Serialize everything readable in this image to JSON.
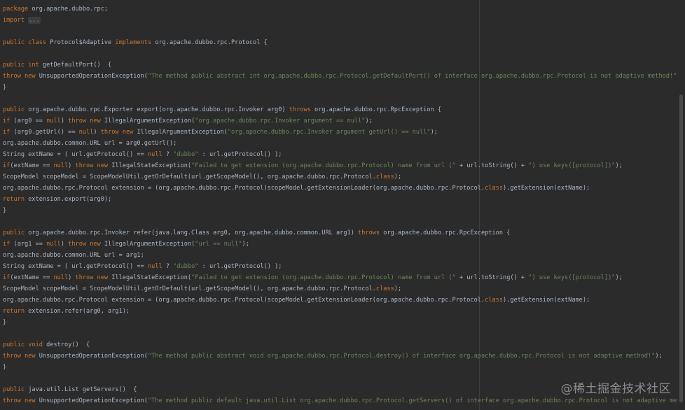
{
  "editor": {
    "lines": [
      {
        "y": 0,
        "tokens": [
          {
            "t": "package",
            "c": "kw"
          },
          {
            "t": " org.apache.dubbo.rpc;",
            "c": "plain"
          }
        ]
      },
      {
        "y": 1,
        "tokens": [
          {
            "t": "import",
            "c": "kw"
          },
          {
            "t": " ",
            "c": "plain"
          },
          {
            "t": "...",
            "c": "fold"
          }
        ]
      },
      {
        "y": 3,
        "tokens": [
          {
            "t": "public class",
            "c": "kw"
          },
          {
            "t": " Protocol$Adaptive ",
            "c": "plain"
          },
          {
            "t": "implements",
            "c": "kw"
          },
          {
            "t": " org.apache.dubbo.rpc.Protocol {",
            "c": "plain"
          }
        ]
      },
      {
        "y": 5,
        "tokens": [
          {
            "t": "public int",
            "c": "kw"
          },
          {
            "t": " getDefaultPort()  {",
            "c": "plain"
          }
        ]
      },
      {
        "y": 6,
        "tokens": [
          {
            "t": "throw new",
            "c": "kw"
          },
          {
            "t": " UnsupportedOperationException(",
            "c": "plain"
          },
          {
            "t": "\"The method public abstract int org.apache.dubbo.rpc.Protocol.getDefaultPort() of interface org.apache.dubbo.rpc.Protocol is not adaptive method!\"",
            "c": "str"
          },
          {
            "t": ");",
            "c": "plain"
          }
        ]
      },
      {
        "y": 7,
        "tokens": [
          {
            "t": "}",
            "c": "plain"
          }
        ]
      },
      {
        "y": 9,
        "tokens": [
          {
            "t": "public",
            "c": "kw"
          },
          {
            "t": " org.apache.dubbo.rpc.Exporter export(org.apache.dubbo.rpc.Invoker arg0) ",
            "c": "plain"
          },
          {
            "t": "throws",
            "c": "kw"
          },
          {
            "t": " org.apache.dubbo.rpc.RpcException {",
            "c": "plain"
          }
        ]
      },
      {
        "y": 10,
        "tokens": [
          {
            "t": "if",
            "c": "kw"
          },
          {
            "t": " (arg0 == ",
            "c": "plain"
          },
          {
            "t": "null",
            "c": "kw"
          },
          {
            "t": ") ",
            "c": "plain"
          },
          {
            "t": "throw new",
            "c": "kw"
          },
          {
            "t": " IllegalArgumentException(",
            "c": "plain"
          },
          {
            "t": "\"org.apache.dubbo.rpc.Invoker argument == null\"",
            "c": "str"
          },
          {
            "t": ");",
            "c": "plain"
          }
        ]
      },
      {
        "y": 11,
        "tokens": [
          {
            "t": "if",
            "c": "kw"
          },
          {
            "t": " (arg0.getUrl() == ",
            "c": "plain"
          },
          {
            "t": "null",
            "c": "kw"
          },
          {
            "t": ") ",
            "c": "plain"
          },
          {
            "t": "throw new",
            "c": "kw"
          },
          {
            "t": " IllegalArgumentException(",
            "c": "plain"
          },
          {
            "t": "\"org.apache.dubbo.rpc.Invoker argument getUrl() == null\"",
            "c": "str"
          },
          {
            "t": ");",
            "c": "plain"
          }
        ]
      },
      {
        "y": 12,
        "tokens": [
          {
            "t": "org.apache.dubbo.common.URL url = arg0.getUrl();",
            "c": "plain"
          }
        ]
      },
      {
        "y": 13,
        "tokens": [
          {
            "t": "String extName = ( url.getProtocol() == ",
            "c": "plain"
          },
          {
            "t": "null",
            "c": "kw"
          },
          {
            "t": " ? ",
            "c": "plain"
          },
          {
            "t": "\"dubbo\"",
            "c": "str"
          },
          {
            "t": " : url.getProtocol() );",
            "c": "plain"
          }
        ]
      },
      {
        "y": 14,
        "tokens": [
          {
            "t": "if",
            "c": "kw"
          },
          {
            "t": "(extName == ",
            "c": "plain"
          },
          {
            "t": "null",
            "c": "kw"
          },
          {
            "t": ") ",
            "c": "plain"
          },
          {
            "t": "throw new",
            "c": "kw"
          },
          {
            "t": " IllegalStateException(",
            "c": "plain"
          },
          {
            "t": "\"Failed to get extension (org.apache.dubbo.rpc.Protocol) name from url (\"",
            "c": "str"
          },
          {
            "t": " + url.toString() + ",
            "c": "plain"
          },
          {
            "t": "\") use keys([protocol])\"",
            "c": "str"
          },
          {
            "t": ");",
            "c": "plain"
          }
        ]
      },
      {
        "y": 15,
        "tokens": [
          {
            "t": "ScopeModel scopeModel = ScopeModelUtil.getOrDefault(url.getScopeModel(), org.apache.dubbo.rpc.Protocol.",
            "c": "plain"
          },
          {
            "t": "class",
            "c": "kw"
          },
          {
            "t": ");",
            "c": "plain"
          }
        ]
      },
      {
        "y": 16,
        "tokens": [
          {
            "t": "org.apache.dubbo.rpc.Protocol extension = (org.apache.dubbo.rpc.Protocol)scopeModel.getExtensionLoader(org.apache.dubbo.rpc.Protocol.",
            "c": "plain"
          },
          {
            "t": "class",
            "c": "kw"
          },
          {
            "t": ").getExtension(extName);",
            "c": "plain"
          }
        ]
      },
      {
        "y": 17,
        "tokens": [
          {
            "t": "return",
            "c": "kw"
          },
          {
            "t": " extension.export(arg0);",
            "c": "plain"
          }
        ]
      },
      {
        "y": 18,
        "tokens": [
          {
            "t": "}",
            "c": "plain"
          }
        ]
      },
      {
        "y": 20,
        "tokens": [
          {
            "t": "public",
            "c": "kw"
          },
          {
            "t": " org.apache.dubbo.rpc.Invoker refer(java.lang.Class arg0, org.apache.dubbo.common.URL arg1) ",
            "c": "plain"
          },
          {
            "t": "throws",
            "c": "kw"
          },
          {
            "t": " org.apache.dubbo.rpc.RpcException {",
            "c": "plain"
          }
        ]
      },
      {
        "y": 21,
        "tokens": [
          {
            "t": "if",
            "c": "kw"
          },
          {
            "t": " (arg1 == ",
            "c": "plain"
          },
          {
            "t": "null",
            "c": "kw"
          },
          {
            "t": ") ",
            "c": "plain"
          },
          {
            "t": "throw new",
            "c": "kw"
          },
          {
            "t": " IllegalArgumentException(",
            "c": "plain"
          },
          {
            "t": "\"url == null\"",
            "c": "str"
          },
          {
            "t": ");",
            "c": "plain"
          }
        ]
      },
      {
        "y": 22,
        "tokens": [
          {
            "t": "org.apache.dubbo.common.URL url = arg1;",
            "c": "plain"
          }
        ]
      },
      {
        "y": 23,
        "tokens": [
          {
            "t": "String extName = ( url.getProtocol() == ",
            "c": "plain"
          },
          {
            "t": "null",
            "c": "kw"
          },
          {
            "t": " ? ",
            "c": "plain"
          },
          {
            "t": "\"dubbo\"",
            "c": "str"
          },
          {
            "t": " : url.getProtocol() );",
            "c": "plain"
          }
        ]
      },
      {
        "y": 24,
        "tokens": [
          {
            "t": "if",
            "c": "kw"
          },
          {
            "t": "(extName == ",
            "c": "plain"
          },
          {
            "t": "null",
            "c": "kw"
          },
          {
            "t": ") ",
            "c": "plain"
          },
          {
            "t": "throw new",
            "c": "kw"
          },
          {
            "t": " IllegalStateException(",
            "c": "plain"
          },
          {
            "t": "\"Failed to get extension (org.apache.dubbo.rpc.Protocol) name from url (\"",
            "c": "str"
          },
          {
            "t": " + url.toString() + ",
            "c": "plain"
          },
          {
            "t": "\") use keys([protocol])\"",
            "c": "str"
          },
          {
            "t": ");",
            "c": "plain"
          }
        ]
      },
      {
        "y": 25,
        "tokens": [
          {
            "t": "ScopeModel scopeModel = ScopeModelUtil.getOrDefault(url.getScopeModel(), org.apache.dubbo.rpc.Protocol.",
            "c": "plain"
          },
          {
            "t": "class",
            "c": "kw"
          },
          {
            "t": ");",
            "c": "plain"
          }
        ]
      },
      {
        "y": 26,
        "tokens": [
          {
            "t": "org.apache.dubbo.rpc.Protocol extension = (org.apache.dubbo.rpc.Protocol)scopeModel.getExtensionLoader(org.apache.dubbo.rpc.Protocol.",
            "c": "plain"
          },
          {
            "t": "class",
            "c": "kw"
          },
          {
            "t": ").getExtension(extName);",
            "c": "plain"
          }
        ]
      },
      {
        "y": 27,
        "tokens": [
          {
            "t": "return",
            "c": "kw"
          },
          {
            "t": " extension.refer(arg0, arg1);",
            "c": "plain"
          }
        ]
      },
      {
        "y": 28,
        "tokens": [
          {
            "t": "}",
            "c": "plain"
          }
        ]
      },
      {
        "y": 30,
        "tokens": [
          {
            "t": "public void",
            "c": "kw"
          },
          {
            "t": " destroy()  {",
            "c": "plain"
          }
        ]
      },
      {
        "y": 31,
        "tokens": [
          {
            "t": "throw new",
            "c": "kw"
          },
          {
            "t": " UnsupportedOperationException(",
            "c": "plain"
          },
          {
            "t": "\"The method public abstract void org.apache.dubbo.rpc.Protocol.destroy() of interface org.apache.dubbo.rpc.Protocol is not adaptive method!\"",
            "c": "str"
          },
          {
            "t": ");",
            "c": "plain"
          }
        ]
      },
      {
        "y": 32,
        "tokens": [
          {
            "t": "}",
            "c": "plain"
          }
        ]
      },
      {
        "y": 34,
        "tokens": [
          {
            "t": "public",
            "c": "kw"
          },
          {
            "t": " java.util.List getServers()  {",
            "c": "plain"
          }
        ]
      },
      {
        "y": 35,
        "tokens": [
          {
            "t": "throw new",
            "c": "kw"
          },
          {
            "t": " UnsupportedOperationException(",
            "c": "plain"
          },
          {
            "t": "\"The method public default java.util.List org.apache.dubbo.rpc.Protocol.getServers() of interface org.apache.dubbo.rpc.Protocol is not adaptive method!\"",
            "c": "str"
          },
          {
            "t": ");",
            "c": "plain"
          }
        ]
      }
    ]
  },
  "watermark": "@稀土掘金技术社区",
  "colors": {
    "background": "#2b2b2b",
    "keyword": "#cc7832",
    "string": "#6a8759",
    "text": "#a9b7c6"
  }
}
